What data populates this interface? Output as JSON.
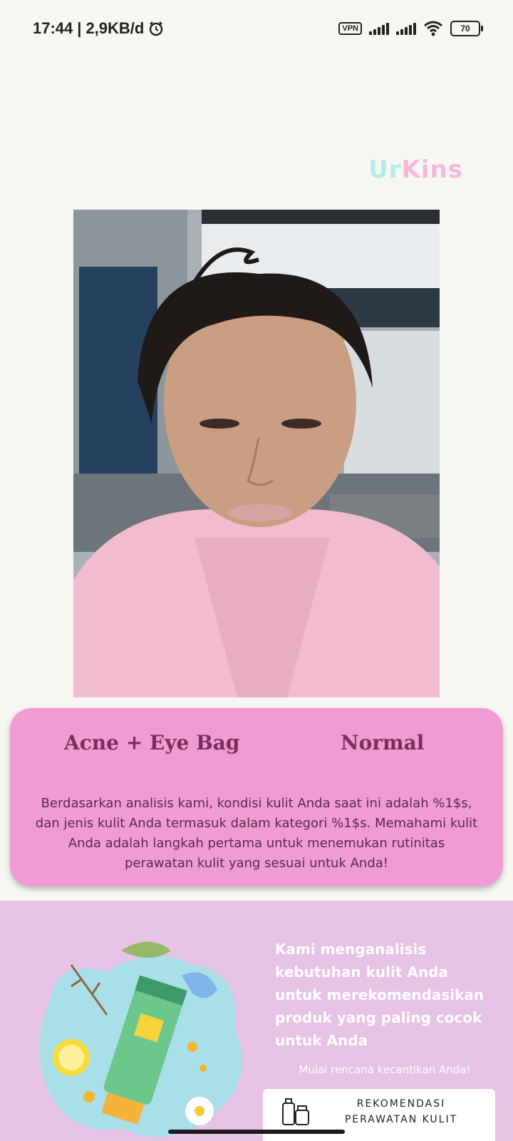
{
  "status_bar": {
    "time": "17:44",
    "separator": "|",
    "data_speed": "2,9KB/d",
    "vpn_label": "VPN",
    "battery_level": "70"
  },
  "app": {
    "logo_part1": "Ur",
    "logo_part2": "Kins"
  },
  "result": {
    "condition": "Acne + Eye Bag",
    "skin_type": "Normal",
    "description": "Berdasarkan analisis kami, kondisi kulit Anda saat ini adalah %1$s, dan jenis kulit Anda termasuk dalam kategori %1$s. Memahami kulit Anda adalah langkah pertama untuk menemukan rutinitas perawatan kulit yang sesuai untuk Anda!"
  },
  "promo": {
    "text": "Kami menganalisis kebutuhan kulit Anda untuk merekomendasikan produk yang paling cocok untuk Anda",
    "cta_text": "Mulai rencana kecantikan Anda!",
    "button_label": "REKOMENDASI PERAWATAN KULIT"
  },
  "colors": {
    "background": "#f7f7f2",
    "card": "#f09bd3",
    "card_text": "#7a2e5f",
    "promo_bg": "#e7c3e6"
  }
}
